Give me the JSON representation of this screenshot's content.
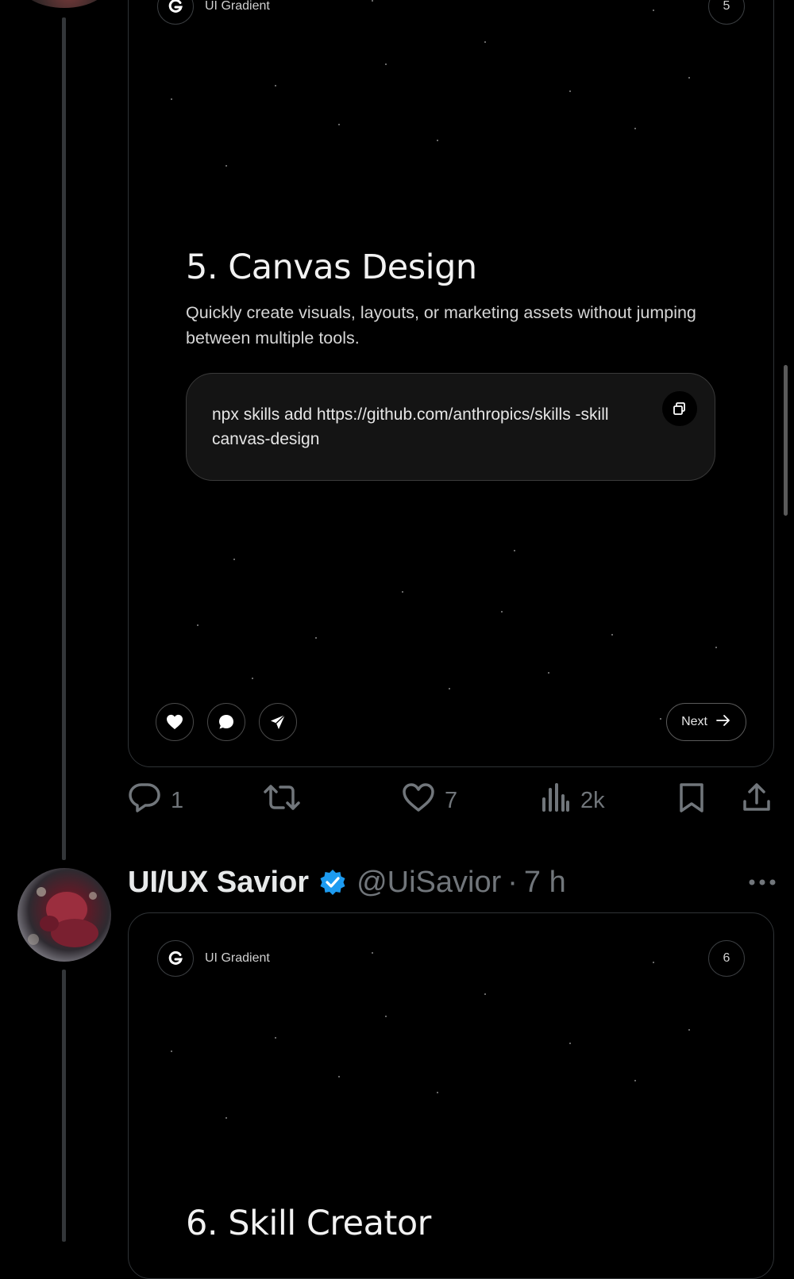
{
  "post1": {
    "card": {
      "brand_name": "UI Gradient",
      "page_number": "5",
      "title": "5. Canvas Design",
      "description": "Quickly create visuals, layouts, or marketing assets without jumping between multiple tools.",
      "command": "npx skills add https://github.com/anthropics/skills -skill canvas-design",
      "next_label": "Next"
    },
    "engagement": {
      "replies": "1",
      "retweets": "",
      "likes": "7",
      "views": "2k"
    }
  },
  "post2": {
    "author": "UI/UX Savior",
    "handle": "@UiSavior",
    "separator": "·",
    "time": "7 h",
    "card": {
      "brand_name": "UI Gradient",
      "page_number": "6",
      "title": "6. Skill Creator"
    }
  },
  "colors": {
    "background": "#000000",
    "muted": "#71767b",
    "verified": "#1d9bf0",
    "card_border": "#2f3336"
  },
  "icons": [
    "gradient-logo-icon",
    "copy-icon",
    "heart-icon",
    "chat-bubble-icon",
    "send-icon",
    "arrow-right-icon",
    "reply-icon",
    "retweet-icon",
    "like-icon",
    "views-icon",
    "bookmark-icon",
    "share-icon",
    "verified-badge-icon",
    "more-icon"
  ]
}
